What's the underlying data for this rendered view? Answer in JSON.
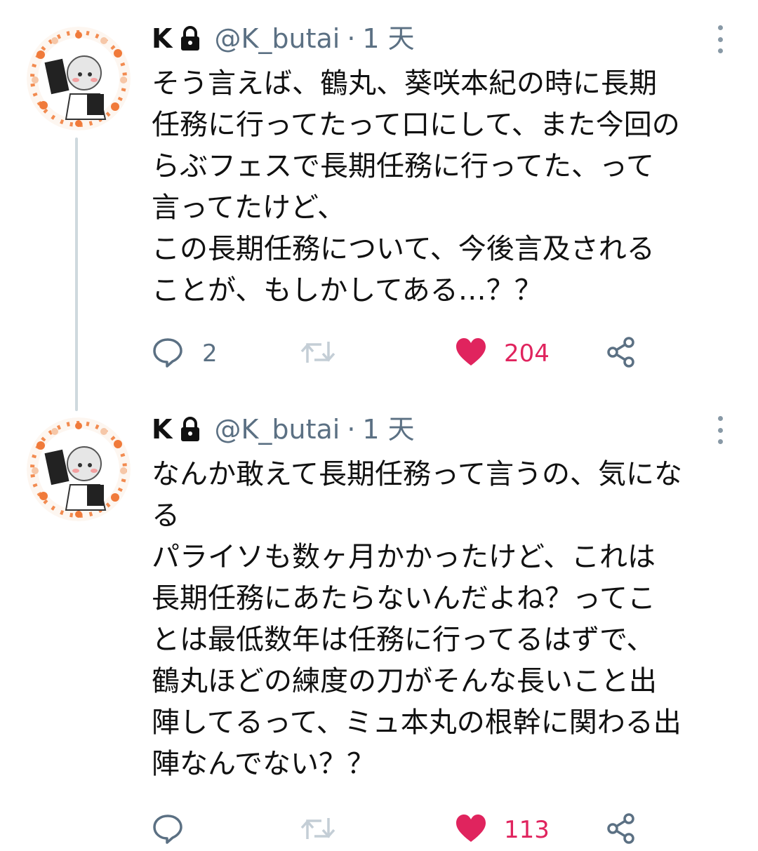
{
  "tweets": [
    {
      "author": {
        "name": "K",
        "handle": "@K_butai",
        "separator": "·",
        "time": "1 天"
      },
      "lines": [
        "そう言えば、鶴丸、葵咲本紀の時に長期",
        "任務に行ってたって口にして、また今回の",
        "らぶフェスで長期任務に行ってた、って",
        "言ってたけど、",
        "この長期任務について、今後言及される",
        "ことが、もしかしてある…？？"
      ],
      "replies": "2",
      "retweets": "",
      "likes": "204",
      "liked": true
    },
    {
      "author": {
        "name": "K",
        "handle": "@K_butai",
        "separator": "·",
        "time": "1 天"
      },
      "lines": [
        "なんか敢えて長期任務って言うの、気にな",
        "る",
        "パライソも数ヶ月かかったけど、これは",
        "長期任務にあたらないんだよね？ってこ",
        "とは最低数年は任務に行ってるはずで、",
        "鶴丸ほどの練度の刀がそんな長いこと出",
        "陣してるって、ミュ本丸の根幹に関わる出",
        "陣なんでない？？"
      ],
      "replies": "",
      "retweets": "",
      "likes": "113",
      "liked": true
    }
  ],
  "icons": {
    "lock": "lock-icon",
    "reply": "reply-icon",
    "retweet": "retweet-icon",
    "like": "heart-icon",
    "share": "share-icon",
    "more": "more-vertical-icon"
  },
  "colors": {
    "like": "#e0245e",
    "muted": "#5b7083",
    "thread_line": "#cfd9de"
  }
}
